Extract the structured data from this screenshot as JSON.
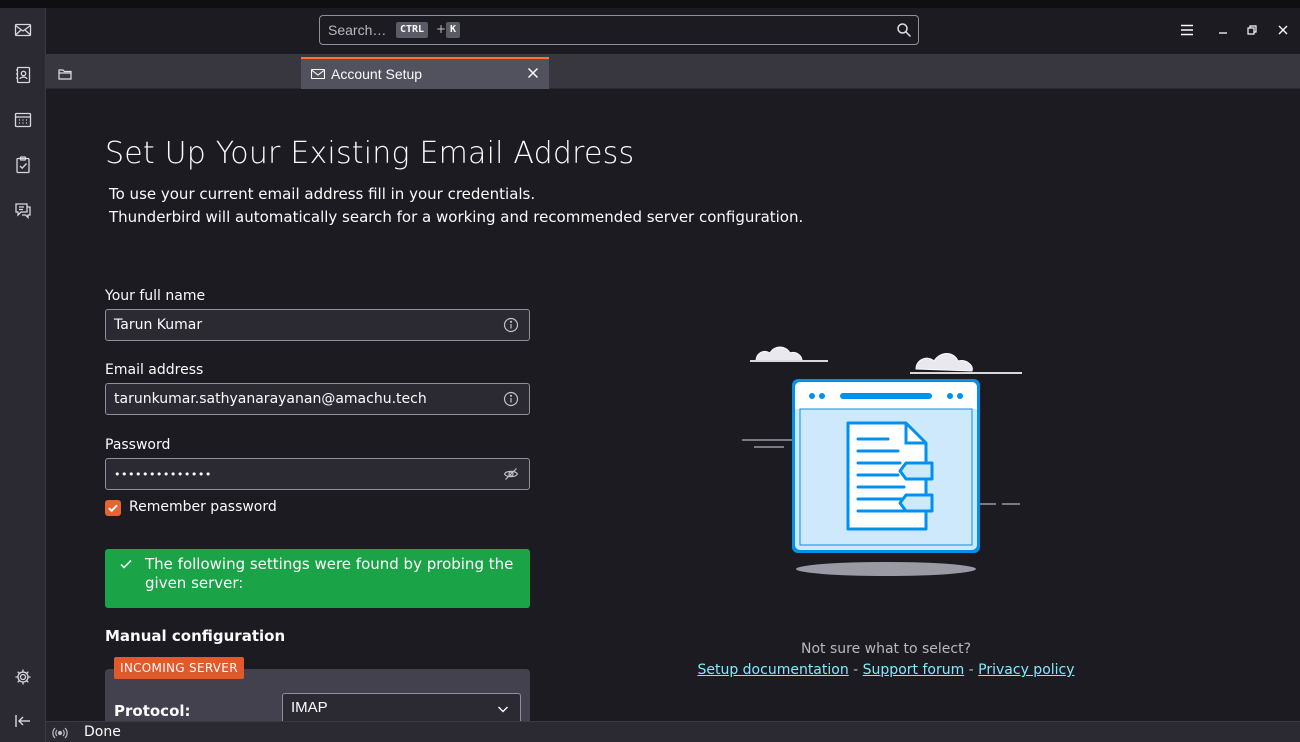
{
  "header": {
    "search_placeholder": "Search…",
    "kbd_ctrl": "CTRL",
    "kbd_plus": "+",
    "kbd_k": "K"
  },
  "tabs": [
    {
      "label": "",
      "icon": "folder-icon"
    },
    {
      "label": "Account Setup",
      "icon": "mail-settings-icon",
      "active": true
    }
  ],
  "spaces": [
    "mail-icon",
    "address-book-icon",
    "calendar-icon",
    "tasks-icon",
    "chat-icon",
    "settings-icon",
    "collapse-icon"
  ],
  "page": {
    "title": "Set Up Your Existing Email Address",
    "subtitle_line1": "To use your current email address fill in your credentials.",
    "subtitle_line2": "Thunderbird will automatically search for a working and recommended server configuration."
  },
  "form": {
    "fullname_label": "Your full name",
    "fullname_value": "Tarun Kumar",
    "email_label": "Email address",
    "email_value": "tarunkumar.sathyanarayanan@amachu.tech",
    "password_label": "Password",
    "password_value": "••••••••••••••",
    "remember_label": "Remember password",
    "remember_checked": true
  },
  "notice": {
    "text": "The following settings were found by probing the given server:"
  },
  "manual": {
    "heading": "Manual configuration",
    "incoming_badge": "INCOMING SERVER",
    "protocol_label": "Protocol:",
    "protocol_value": "IMAP"
  },
  "help": {
    "question": "Not sure what to select?",
    "link_docs": "Setup documentation",
    "sep1": " - ",
    "link_forum": "Support forum",
    "sep2": " - ",
    "link_privacy": "Privacy policy"
  },
  "statusbar": {
    "label": "Done"
  },
  "colors": {
    "accent": "#ff7139",
    "success": "#1aa347",
    "link": "#80ebff",
    "badge": "#e25a2c"
  }
}
